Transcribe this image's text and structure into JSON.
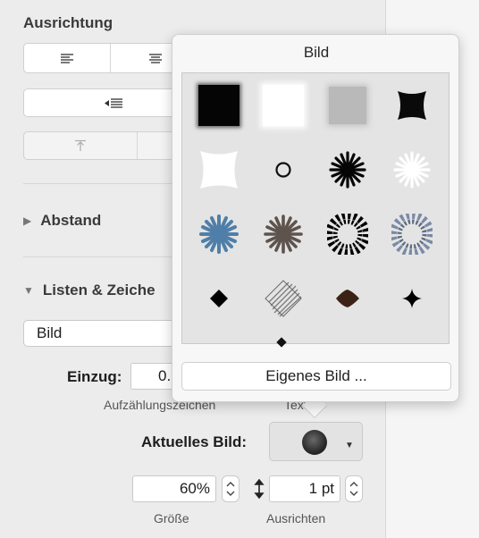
{
  "sidebar": {
    "alignment_header": "Ausrichtung",
    "spacing_label": "Abstand",
    "lists_label": "Listen & Zeiche",
    "bullet_type": "Bild",
    "indent_label": "Einzug:",
    "indent_value": "0.",
    "bullets_caption": "Aufzählungszeichen",
    "text_caption": "Text",
    "current_image_label": "Aktuelles Bild:",
    "size_value": "60%",
    "size_caption": "Größe",
    "align_value": "1 pt",
    "align_caption": "Ausrichten"
  },
  "popover": {
    "title": "Bild",
    "custom_button": "Eigenes Bild ..."
  },
  "colors": {
    "panel_bg": "#ececec",
    "popover_bg": "#f7f7f7",
    "grid_bg": "#e4e4e4",
    "blue_burst": "#4f7fa8",
    "brown_burst": "#5e534d",
    "slate_burst": "#7a8aa6",
    "dark_brown_diamond": "#3b2216"
  },
  "icons": [
    "align-left-icon",
    "align-center-icon",
    "decrease-indent-icon",
    "align-top-icon",
    "disclosure-right-icon",
    "disclosure-down-icon",
    "dropdown-chevron-icon",
    "stepper-icon",
    "vertical-arrow-icon"
  ]
}
